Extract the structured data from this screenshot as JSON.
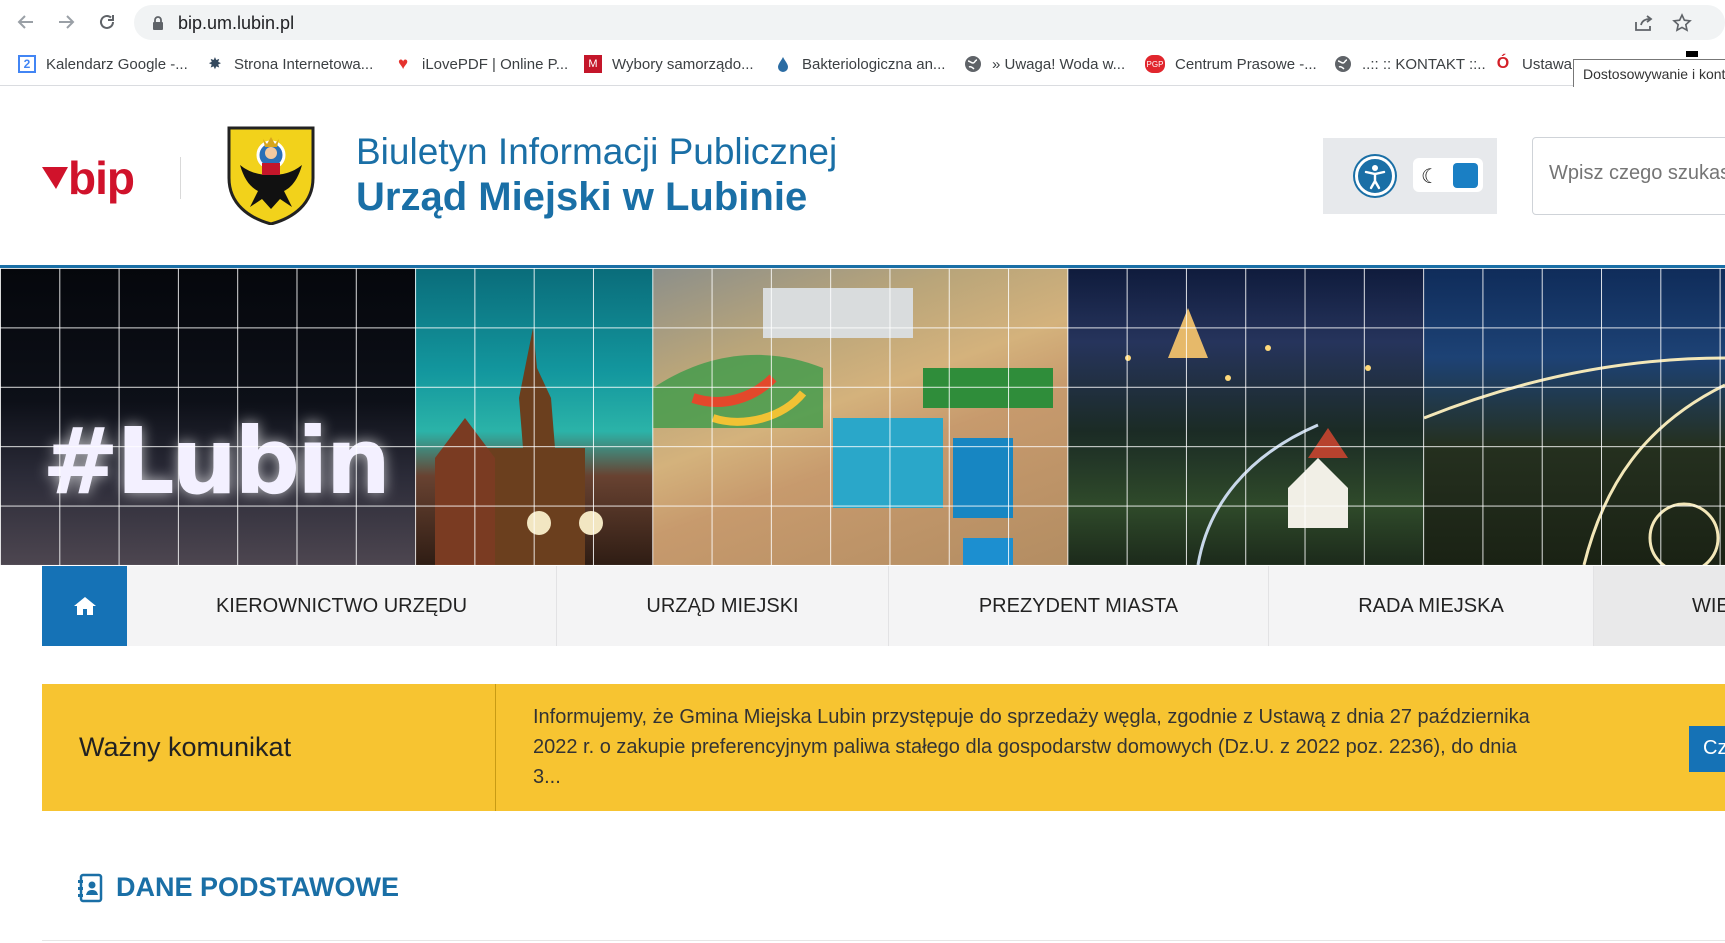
{
  "browser": {
    "url": "bip.um.lubin.pl",
    "bookmarks": [
      {
        "label": "Kalendarz Google -...",
        "icon": "google-calendar-icon"
      },
      {
        "label": "Strona Internetowa...",
        "icon": "police-badge-icon"
      },
      {
        "label": "iLovePDF | Online P...",
        "icon": "heart-icon"
      },
      {
        "label": "Wybory samorządo...",
        "icon": "ballot-icon"
      },
      {
        "label": "Bakteriologiczna an...",
        "icon": "water-drop-icon"
      },
      {
        "label": "» Uwaga! Woda w...",
        "icon": "globe-icon"
      },
      {
        "label": "Centrum Prasowe -...",
        "icon": "pgp-icon"
      },
      {
        "label": "..:: :: KONTAKT ::..",
        "icon": "globe-icon"
      },
      {
        "label": "Ustawa",
        "icon": "opera-icon"
      }
    ],
    "tooltip": "Dostosowywanie i kontrolowanie"
  },
  "header": {
    "logo_text": "bip",
    "title_line1": "Biuletyn Informacji Publicznej",
    "title_line2": "Urząd Miejski w Lubinie",
    "search_placeholder": "Wpisz czego szukasz"
  },
  "banner": {
    "hashtag": "#Lubin"
  },
  "menu": {
    "items": [
      {
        "label": "KIEROWNICTWO URZĘDU"
      },
      {
        "label": "URZĄD MIEJSKI"
      },
      {
        "label": "PREZYDENT MIASTA"
      },
      {
        "label": "RADA MIEJSKA"
      }
    ],
    "more_label": "WIĘCEJ"
  },
  "announcement": {
    "title": "Ważny komunikat",
    "text": "Informujemy, że Gmina Miejska Lubin przystępuje do sprzedaży węgla, zgodnie z Ustawą z dnia 27 października 2022 r. o zakupie preferencyjnym paliwa stałego dla gospodarstw domowych (Dz.U. z 2022 poz. 2236), do dnia 3...",
    "button_label": "Czytaj"
  },
  "section": {
    "title": "DANE PODSTAWOWE"
  },
  "colors": {
    "brand_blue": "#1a6fa6",
    "menu_home_blue": "#1572b6",
    "alert_yellow": "#f7c431",
    "bip_red": "#d0122b"
  }
}
